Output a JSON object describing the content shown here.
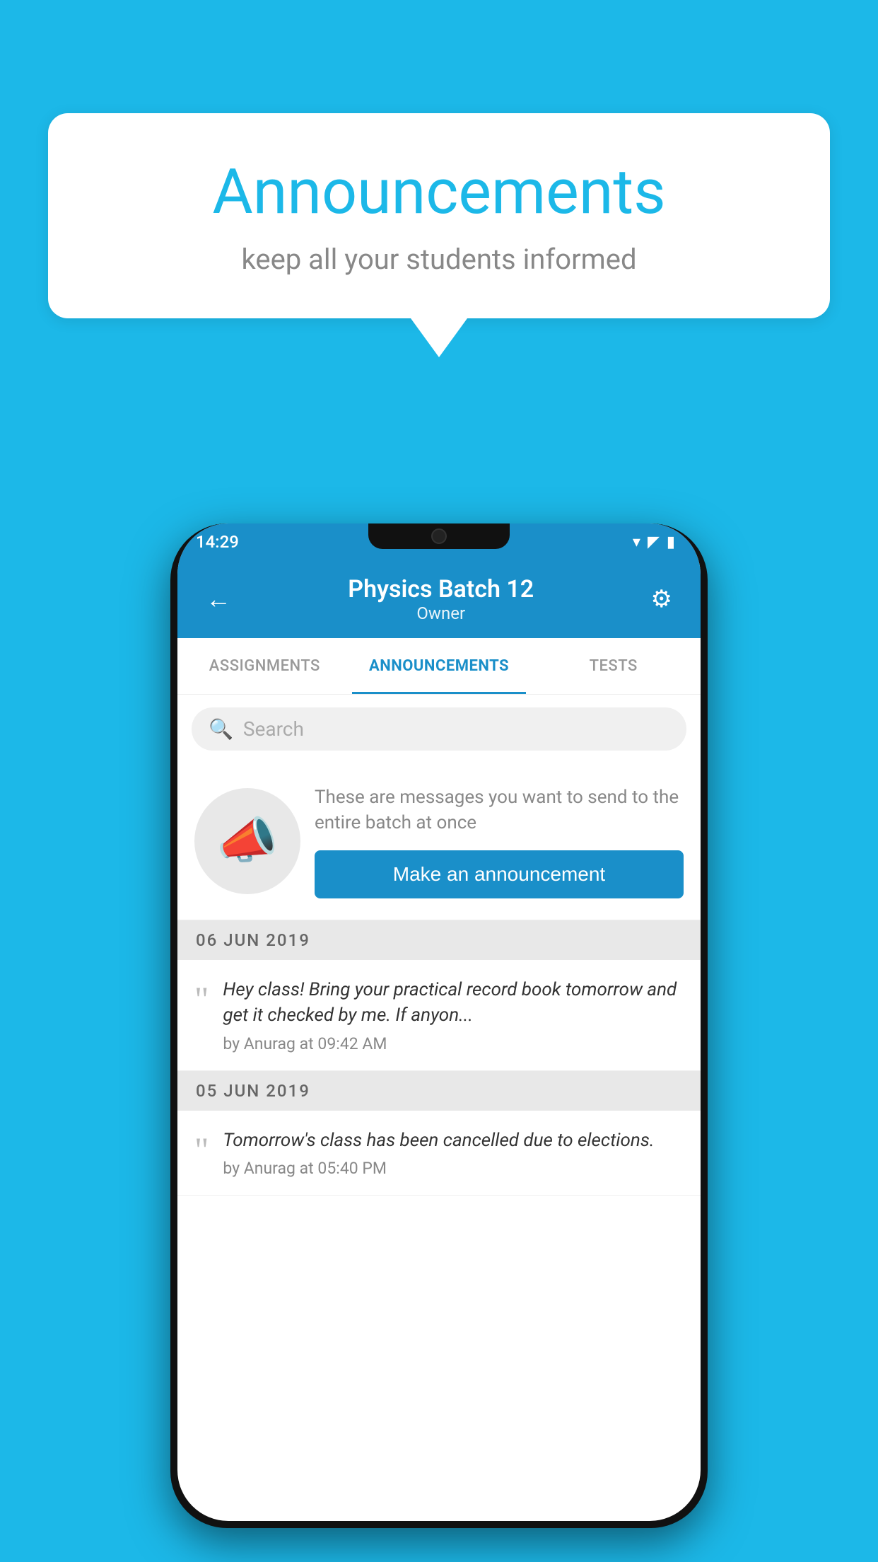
{
  "background_color": "#1cb8e8",
  "speech_bubble": {
    "title": "Announcements",
    "subtitle": "keep all your students informed"
  },
  "phone": {
    "status_bar": {
      "time": "14:29"
    },
    "app_bar": {
      "title": "Physics Batch 12",
      "subtitle": "Owner",
      "back_label": "←",
      "settings_label": "⚙"
    },
    "tabs": [
      {
        "label": "ASSIGNMENTS",
        "active": false
      },
      {
        "label": "ANNOUNCEMENTS",
        "active": true
      },
      {
        "label": "TESTS",
        "active": false
      },
      {
        "label": "...",
        "active": false
      }
    ],
    "search": {
      "placeholder": "Search"
    },
    "promo": {
      "description": "These are messages you want to send to the entire batch at once",
      "button_label": "Make an announcement"
    },
    "announcements": [
      {
        "date": "06  JUN  2019",
        "text": "Hey class! Bring your practical record book tomorrow and get it checked by me. If anyon...",
        "meta": "by Anurag at 09:42 AM"
      },
      {
        "date": "05  JUN  2019",
        "text": "Tomorrow's class has been cancelled due to elections.",
        "meta": "by Anurag at 05:40 PM"
      }
    ]
  }
}
